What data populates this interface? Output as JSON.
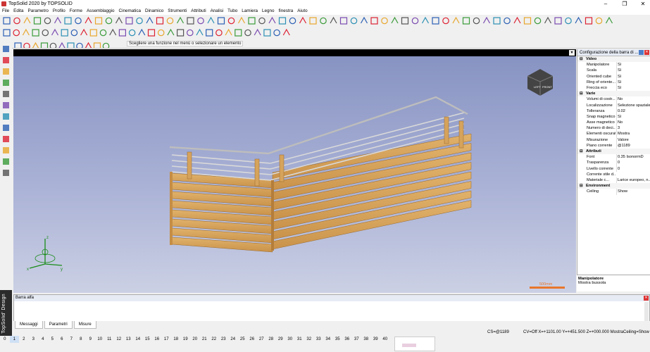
{
  "app": {
    "title": "TopSolid 2020 by TOPSOLID"
  },
  "menu": [
    "File",
    "Edita",
    "Parametro",
    "Profilo",
    "Forme",
    "Assemblaggio",
    "Cinematica",
    "Dinamico",
    "Strumenti",
    "Attributi",
    "Analisi",
    "Tubo",
    "Lamiera",
    "Legno",
    "finestra",
    "Aiuto"
  ],
  "prompt": "Scegliere una funzione nel menù o selezionare un elemento",
  "panel": {
    "title": "Configurazione della barra di ...",
    "sections": [
      {
        "name": "Video",
        "rows": [
          [
            "Manipolatore",
            "Sì"
          ],
          [
            "Scala",
            "Sì"
          ],
          [
            "Oriented cube",
            "Sì"
          ],
          [
            "Ring of oriente...",
            "Sì"
          ],
          [
            "Freccia eco",
            "Sì"
          ]
        ]
      },
      {
        "name": "Varie",
        "rows": [
          [
            "Volumi di costr...",
            "No"
          ],
          [
            "Localizzazione",
            "Selezione spaziale"
          ],
          [
            "Tolleranza",
            "0.02"
          ],
          [
            "Snap magnetico",
            "Sì"
          ],
          [
            "Asse magnetico",
            "No"
          ],
          [
            "Numero di deci...",
            "3"
          ],
          [
            "Elementi oscurati",
            "Mostra"
          ],
          [
            "Misurazione",
            "Valore"
          ],
          [
            "Piano corrente",
            "@1189"
          ]
        ]
      },
      {
        "name": "Attributi",
        "rows": [
          [
            "Font",
            "0.35  IsonormD"
          ],
          [
            "Trasparenza",
            "0"
          ],
          [
            "Livello corrente",
            "0"
          ],
          [
            "Corrente stile d...",
            ""
          ],
          [
            "Materiale c...",
            "Larice europeo, n..."
          ]
        ]
      },
      {
        "name": "Environment",
        "rows": [
          [
            "Ceiling",
            "Show"
          ]
        ]
      }
    ],
    "desc_title": "Manipolatore",
    "desc_text": "Mostra bussola"
  },
  "viewport": {
    "scale_label": "500mm",
    "cube_left": "LEFT",
    "cube_front": "FRONT"
  },
  "alpha": {
    "title": "Barra alfa"
  },
  "tabs": [
    "Messaggi",
    "Parametri",
    "Misure"
  ],
  "status": {
    "cs": "CS=@1189",
    "coords": "CV=Off  X=+1101.00  Y=+451.500  Z=+000.000  Mostra",
    "ceiling": "Ceiling=Show"
  },
  "pages": [
    "0",
    "1",
    "2",
    "3",
    "4",
    "5",
    "6",
    "7",
    "8",
    "9",
    "10",
    "11",
    "12",
    "13",
    "14",
    "15",
    "16",
    "17",
    "18",
    "19",
    "20",
    "21",
    "22",
    "23",
    "24",
    "25",
    "26",
    "27",
    "28",
    "29",
    "30",
    "31",
    "32",
    "33",
    "34",
    "35",
    "36",
    "37",
    "38",
    "39",
    "40"
  ],
  "brand": "TopSolid' Design"
}
